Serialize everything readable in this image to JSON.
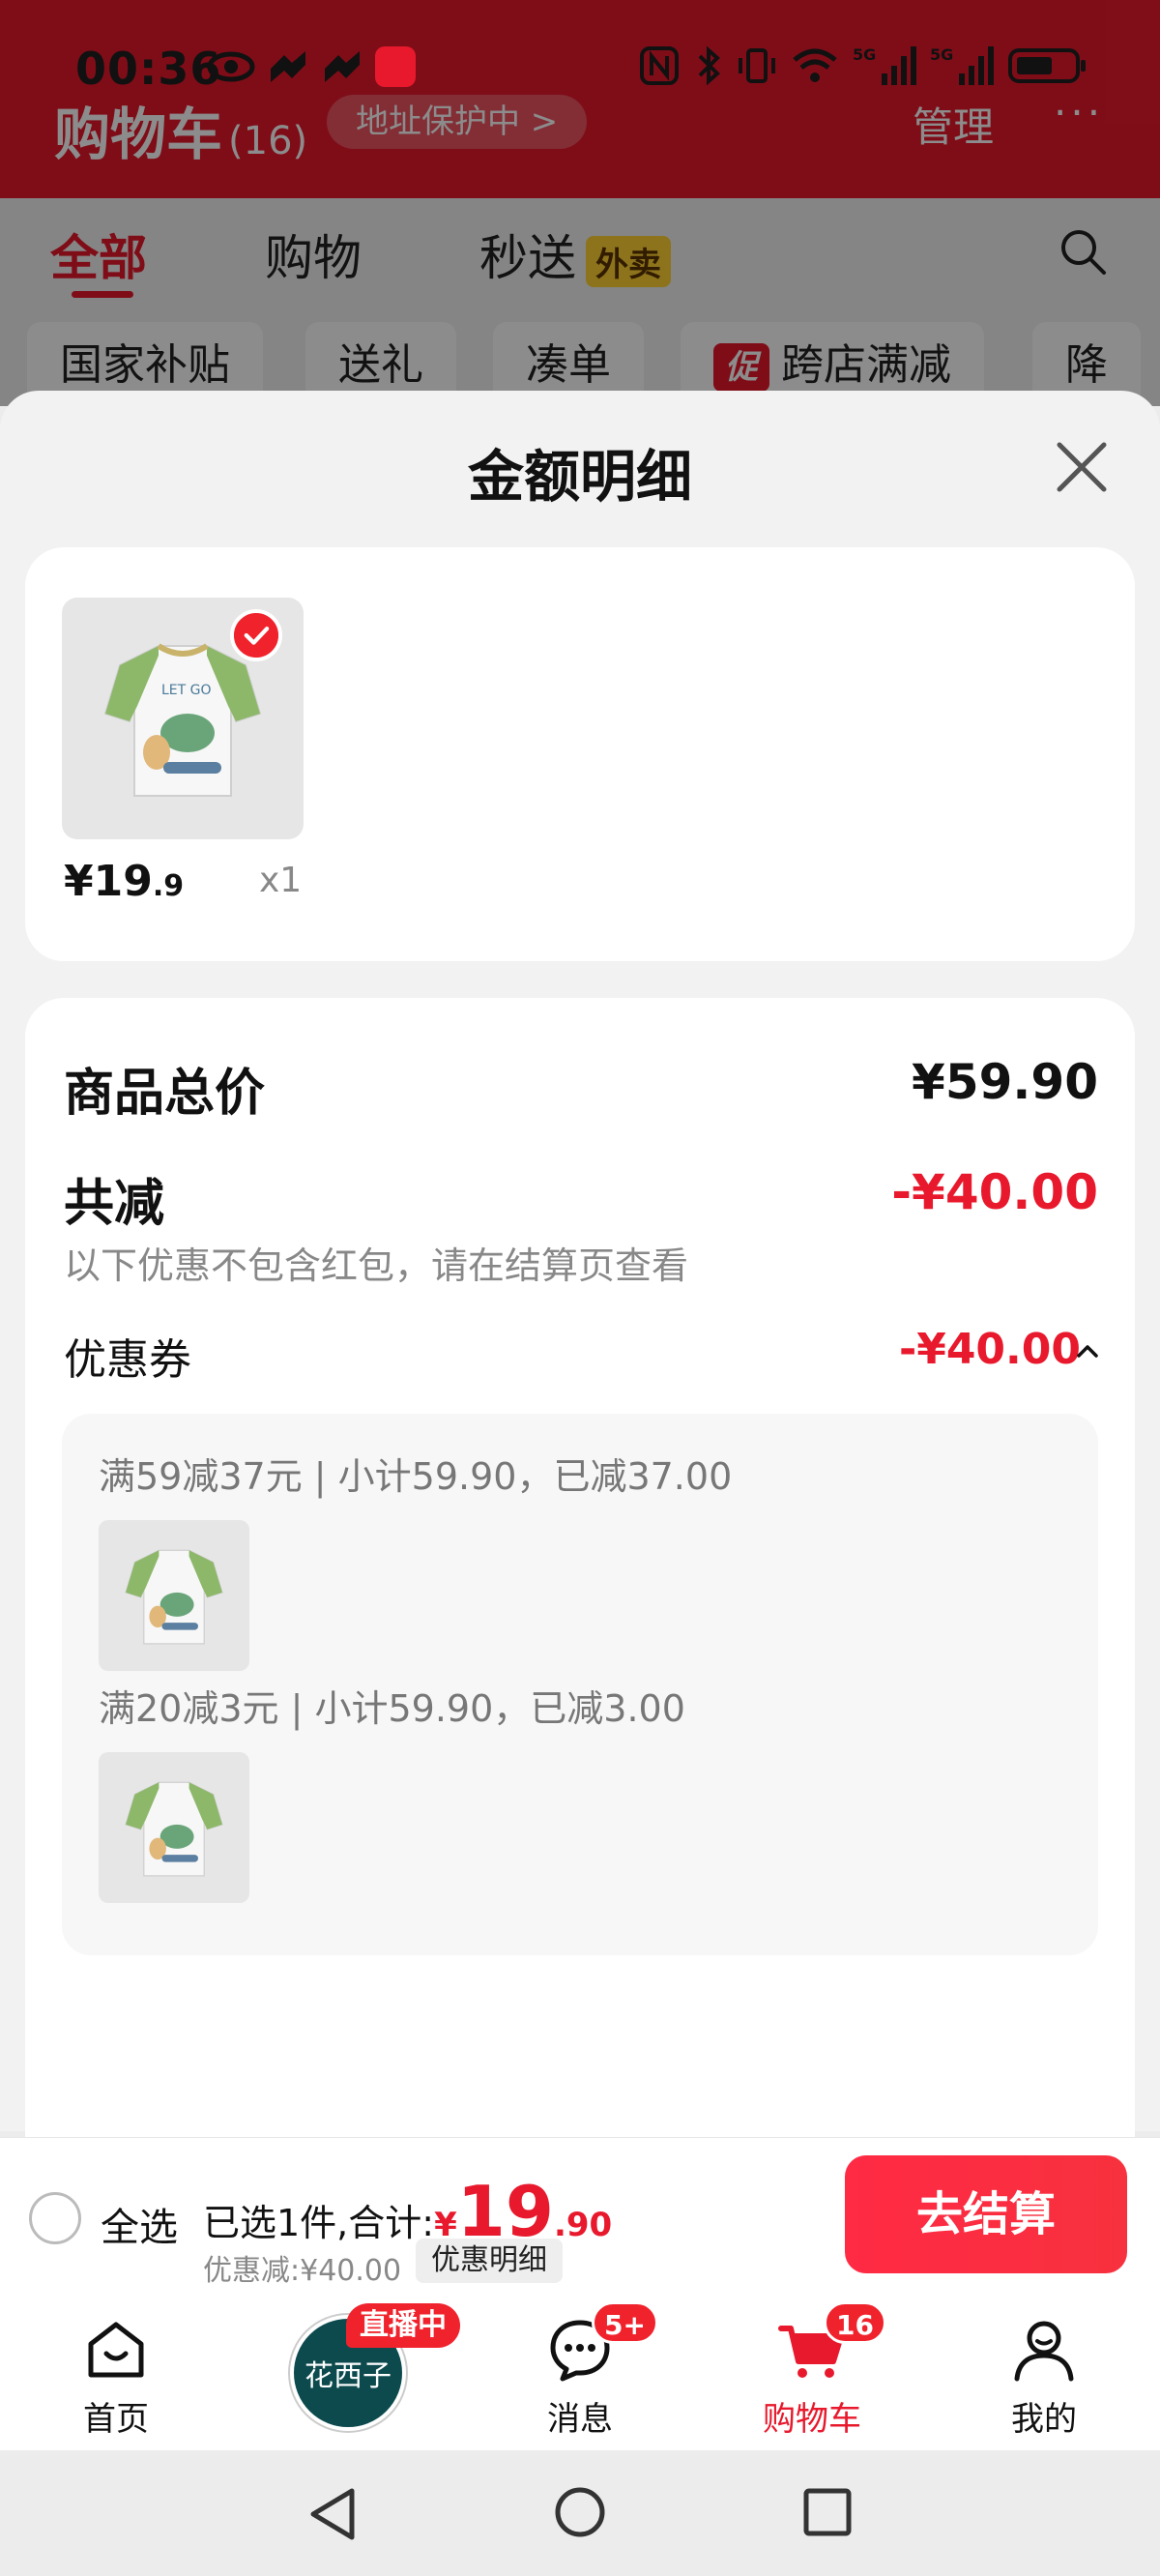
{
  "status_bar": {
    "time": "00:36"
  },
  "background": {
    "title": "购物车",
    "count": "(16)",
    "address": "地址保护中 >",
    "manage": "管理",
    "more": "···",
    "tabs": [
      {
        "label": "全部"
      },
      {
        "label": "购物"
      },
      {
        "label": "秒送"
      }
    ],
    "tab_badge": "外卖",
    "chips": [
      {
        "label": "国家补贴"
      },
      {
        "label": "送礼"
      },
      {
        "label": "凑单"
      },
      {
        "label": "跨店满减"
      },
      {
        "label": "降"
      }
    ],
    "promo_tag": "促"
  },
  "sheet": {
    "title": "金额明细",
    "item": {
      "price_int": "¥19",
      "price_dec": ".9",
      "quantity": "x1"
    },
    "total_label": "商品总价",
    "total_value": "¥59.90",
    "reduce_label": "共减",
    "reduce_value": "-¥40.00",
    "reduce_note": "以下优惠不包含红包，请在结算页查看",
    "coupon_label": "优惠券",
    "coupon_value": "-¥40.00",
    "coupon_rules": [
      {
        "text": "满59减37元 | 小计59.90，已减37.00"
      },
      {
        "text": "满20减3元 | 小计59.90，已减3.00"
      }
    ]
  },
  "checkout": {
    "select_all": "全选",
    "summary_prefix": "已选1件,合计:",
    "currency": "¥",
    "amount_int": "19",
    "amount_dec": ".90",
    "discount": "优惠减:¥40.00",
    "detail_button": "优惠明细",
    "checkout_button": "去结算"
  },
  "tab_bar": {
    "items": [
      {
        "label": "首页"
      },
      {
        "label": "花西子"
      },
      {
        "label": "消息"
      },
      {
        "label": "购物车"
      },
      {
        "label": "我的"
      }
    ],
    "live_badge": "直播中",
    "messages_badge": "5+",
    "cart_badge": "16",
    "active_color": "#e8192c"
  }
}
